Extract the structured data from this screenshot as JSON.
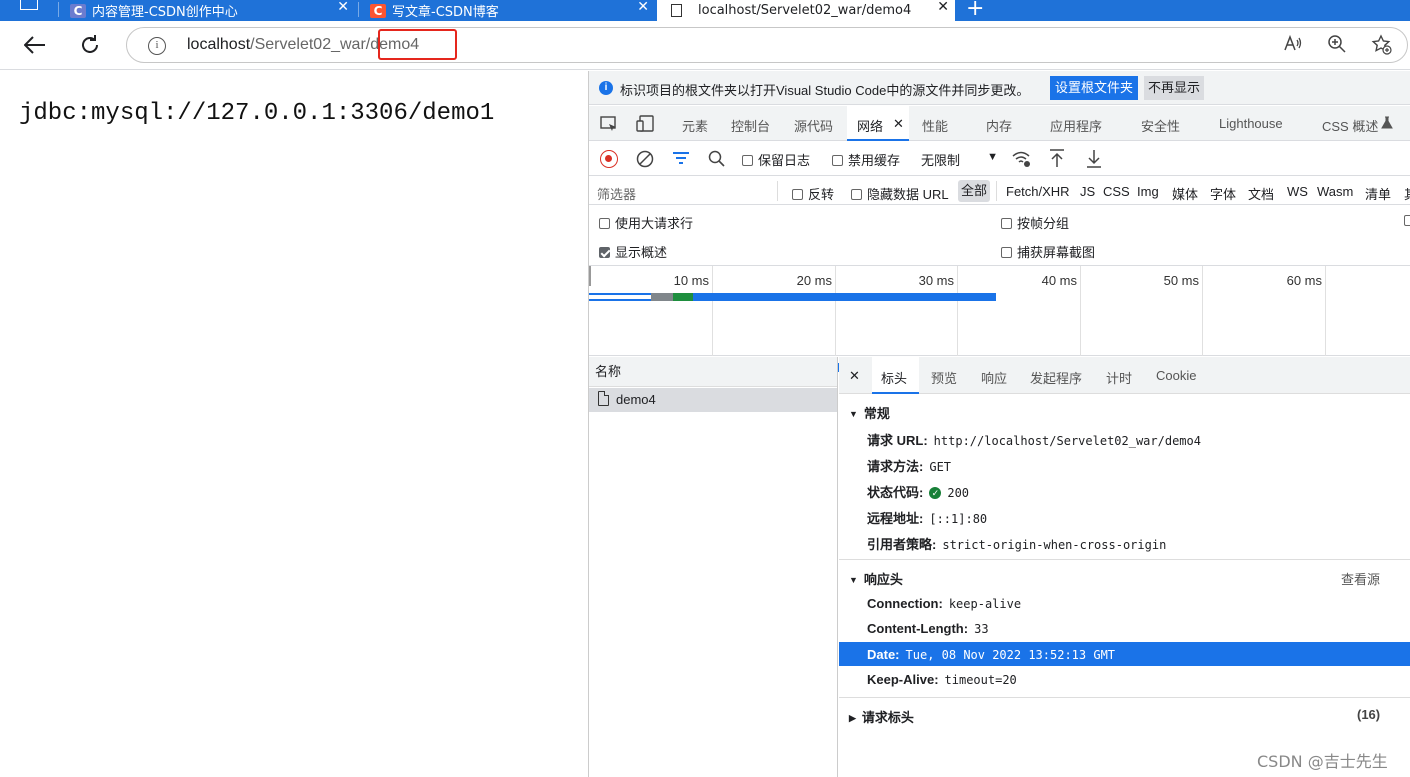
{
  "browser": {
    "tabs": [
      {
        "title": "内容管理-CSDN创作中心",
        "close": "✕"
      },
      {
        "title": "写文章-CSDN博客",
        "close": "✕"
      },
      {
        "title": "localhost/Servelet02_war/demo4",
        "close": "✕"
      }
    ],
    "new_tab": "+",
    "url_host": "localhost",
    "url_path": "/Servelet02_war/demo4",
    "info_icon": "i"
  },
  "page": {
    "content": "jdbc:mysql://127.0.0.1:3306/demo1"
  },
  "devtools": {
    "infobar": {
      "icon": "i",
      "message": "标识项目的根文件夹以打开Visual Studio Code中的源文件并同步更改。",
      "primary_button": "设置根文件夹",
      "secondary_button": "不再显示"
    },
    "tabs": [
      "元素",
      "控制台",
      "源代码",
      "网络",
      "性能",
      "内存",
      "应用程序",
      "安全性",
      "Lighthouse",
      "CSS 概述"
    ],
    "active_tab_close": "✕",
    "toolbar": {
      "preserve_log": "保留日志",
      "disable_cache": "禁用缓存",
      "throttle": "无限制"
    },
    "filter": {
      "placeholder": "筛选器",
      "invert": "反转",
      "hide_data_urls": "隐藏数据 URL",
      "all": "全部",
      "types": [
        "Fetch/XHR",
        "JS",
        "CSS",
        "Img",
        "媒体",
        "字体",
        "文档",
        "WS",
        "Wasm",
        "清单",
        "其"
      ]
    },
    "options": {
      "large_rows": "使用大请求行",
      "group_by_frame": "按帧分组",
      "show_overview": "显示概述",
      "capture_screenshots": "捕获屏幕截图"
    },
    "timeline": {
      "ticks": [
        "10 ms",
        "20 ms",
        "30 ms",
        "40 ms",
        "50 ms",
        "60 ms"
      ]
    },
    "request_list": {
      "header": "名称",
      "rows": [
        "demo4"
      ]
    },
    "detail": {
      "close": "✕",
      "tabs": [
        "标头",
        "预览",
        "响应",
        "发起程序",
        "计时",
        "Cookie"
      ],
      "general": {
        "title": "常规",
        "request_url_label": "请求 URL:",
        "request_url": "http://localhost/Servelet02_war/demo4",
        "method_label": "请求方法:",
        "method": "GET",
        "status_label": "状态代码:",
        "status": "200",
        "remote_label": "远程地址:",
        "remote": "[::1]:80",
        "referrer_label": "引用者策略:",
        "referrer": "strict-origin-when-cross-origin"
      },
      "response_headers": {
        "title": "响应头",
        "view_source": "查看源",
        "items": [
          {
            "k": "Connection:",
            "v": "keep-alive"
          },
          {
            "k": "Content-Length:",
            "v": "33"
          },
          {
            "k": "Date:",
            "v": "Tue, 08 Nov 2022 13:52:13 GMT"
          },
          {
            "k": "Keep-Alive:",
            "v": "timeout=20"
          }
        ]
      },
      "request_headers": {
        "title": "请求标头",
        "count": "(16)"
      }
    }
  },
  "watermark": "CSDN @吉士先生",
  "colors": {
    "accent": "#1a73e8",
    "tabbar": "#1f72d8",
    "highlight_box": "#e5261d",
    "csdn_red": "#fc5531"
  }
}
